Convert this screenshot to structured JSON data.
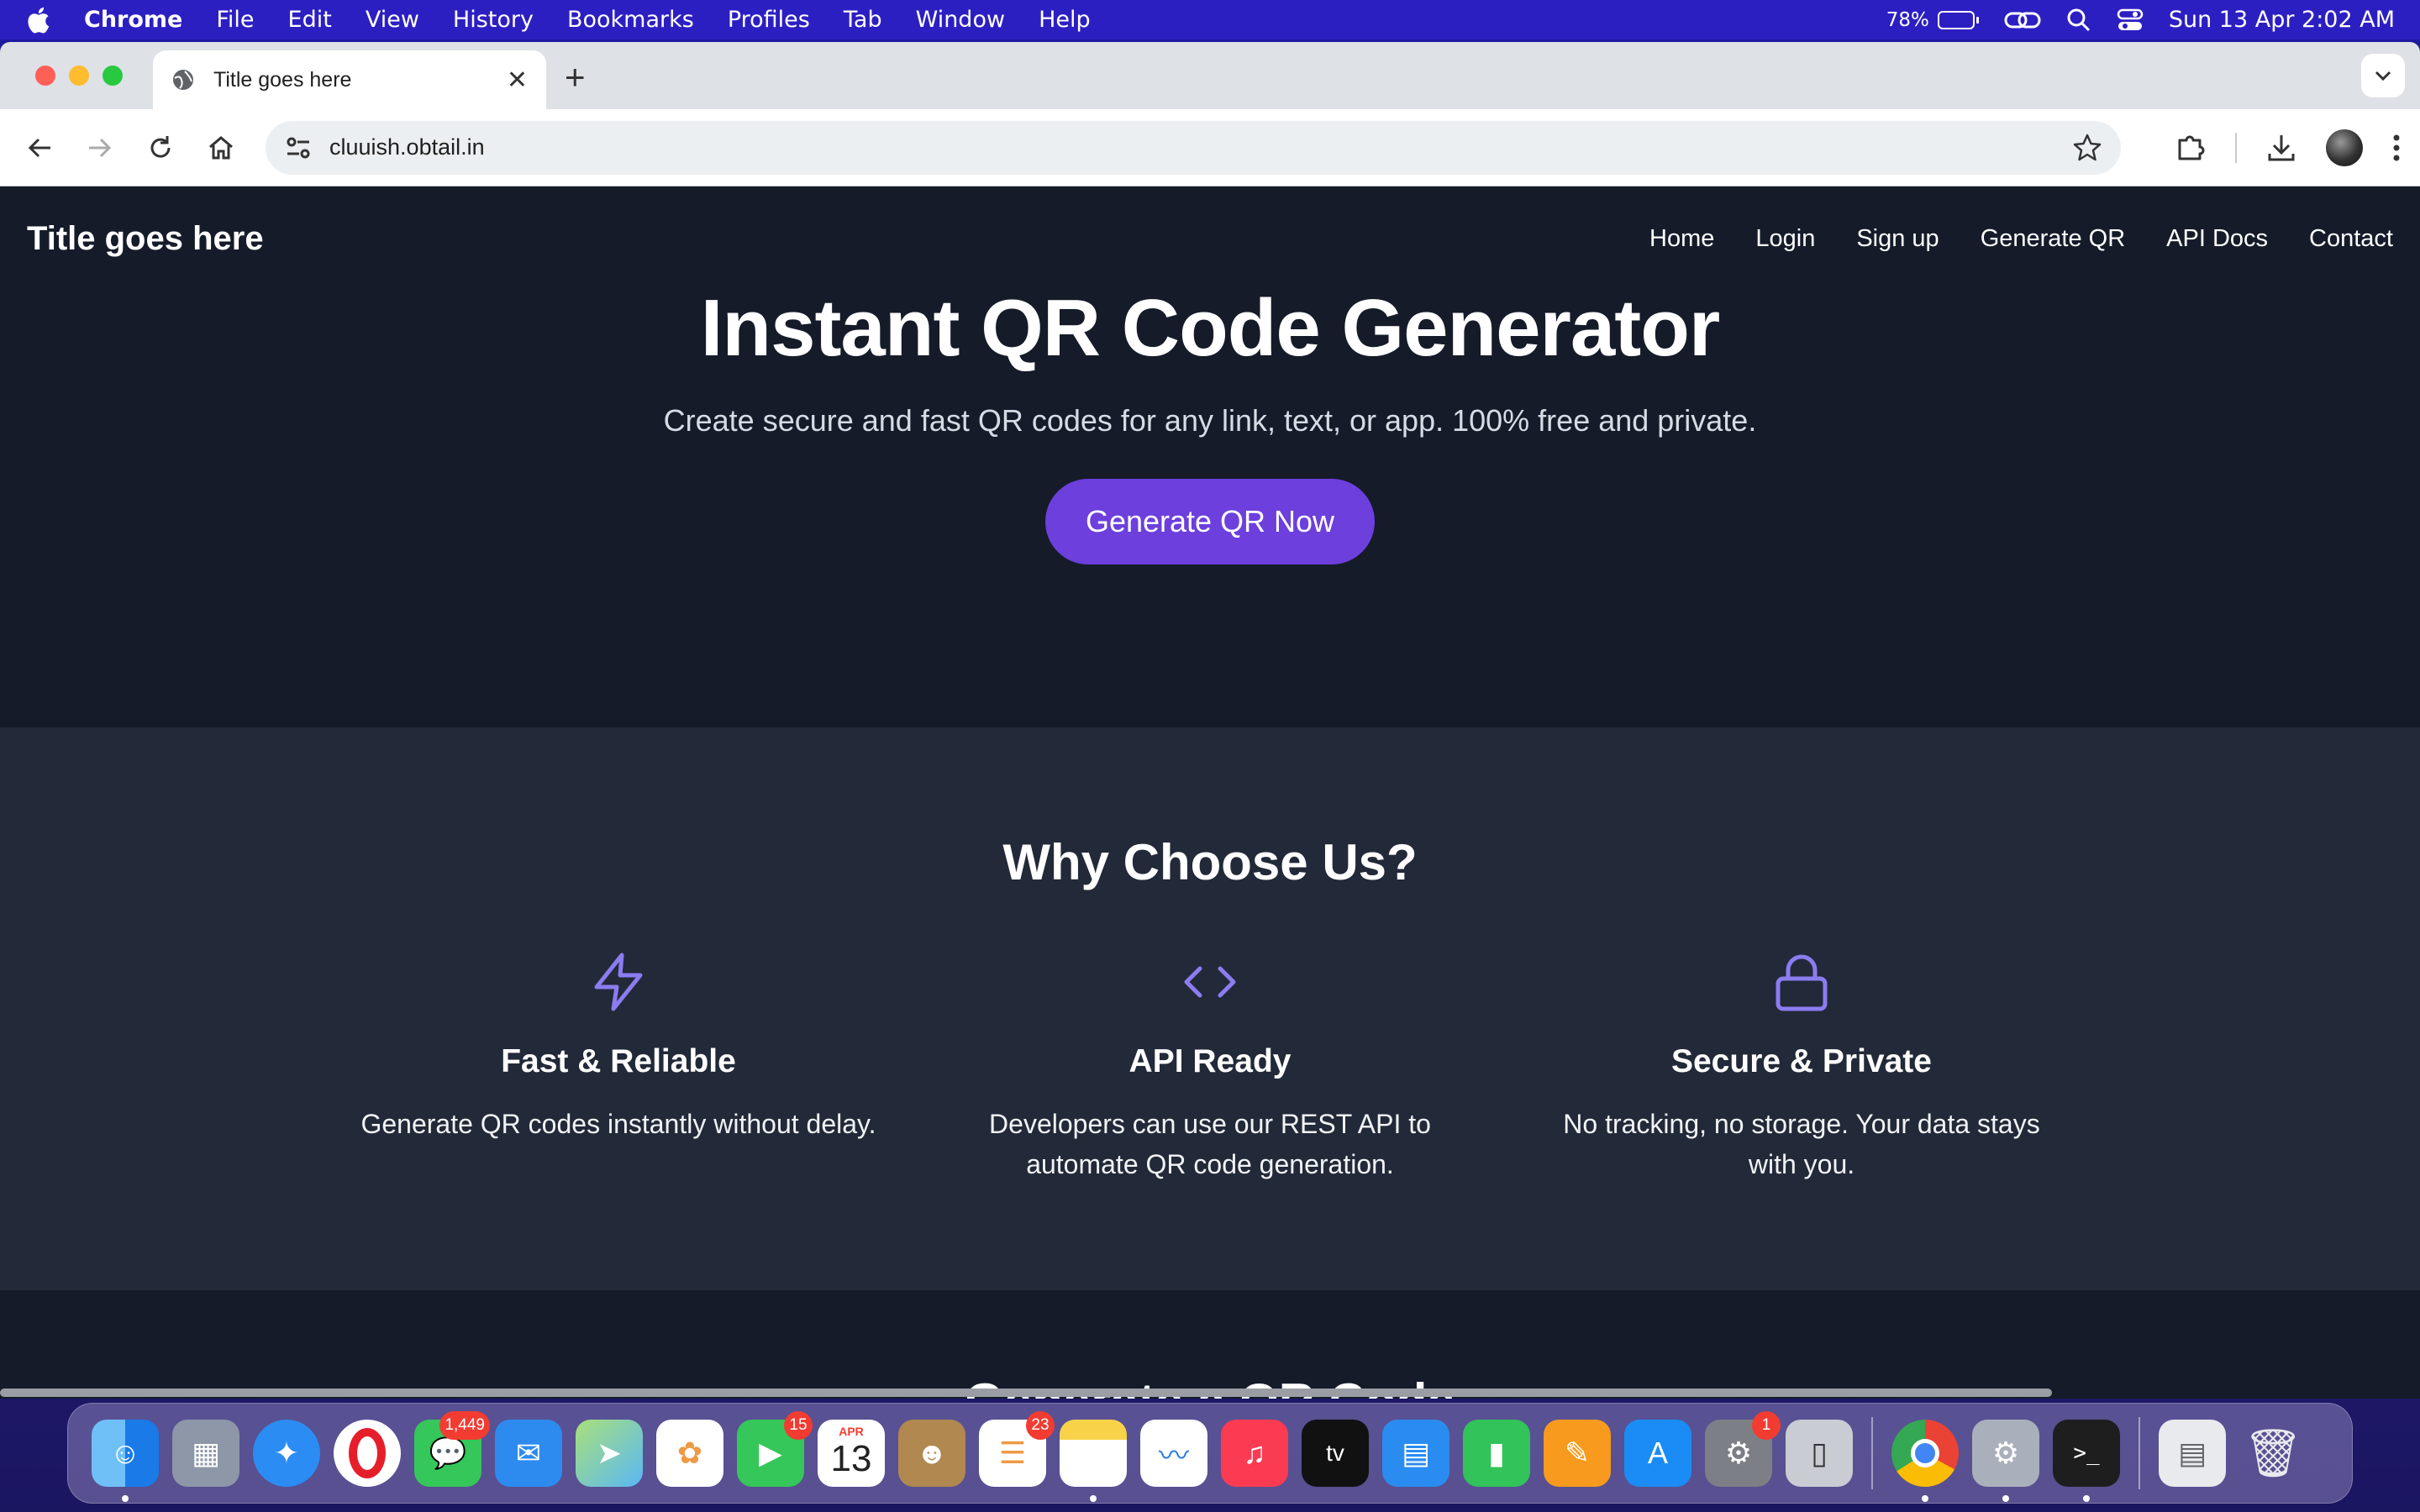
{
  "menubar": {
    "app_name": "Chrome",
    "menus": [
      "File",
      "Edit",
      "View",
      "History",
      "Bookmarks",
      "Profiles",
      "Tab",
      "Window",
      "Help"
    ],
    "battery_percent": "78%",
    "battery_level": 0.78,
    "datetime": "Sun 13 Apr  2:02 AM"
  },
  "browser": {
    "tab_title": "Title goes here",
    "url": "cluuish.obtail.in"
  },
  "site": {
    "brand": "Title goes here",
    "nav": [
      "Home",
      "Login",
      "Sign up",
      "Generate QR",
      "API Docs",
      "Contact"
    ],
    "hero": {
      "title": "Instant QR Code Generator",
      "subtitle": "Create secure and fast QR codes for any link, text, or app. 100% free and private.",
      "cta": "Generate QR Now"
    },
    "features": {
      "heading": "Why Choose Us?",
      "items": [
        {
          "icon": "lightning-icon",
          "title": "Fast & Reliable",
          "text": "Generate QR codes instantly without delay."
        },
        {
          "icon": "code-icon",
          "title": "API Ready",
          "text": "Developers can use our REST API to automate QR code generation."
        },
        {
          "icon": "lock-icon",
          "title": "Secure & Private",
          "text": "No tracking, no storage. Your data stays with you."
        }
      ]
    },
    "generate_heading": "Generate a QR Code"
  },
  "dock": {
    "messages_badge": "1,449",
    "facetime_badge": "15",
    "calendar_month": "APR",
    "calendar_day": "13",
    "reminders_badge": "23",
    "settings_badge": "1"
  },
  "colors": {
    "accent": "#6d3fdc",
    "icon_purple": "#8b7cf0",
    "page_bg": "#151b29",
    "section_bg": "#222938"
  }
}
